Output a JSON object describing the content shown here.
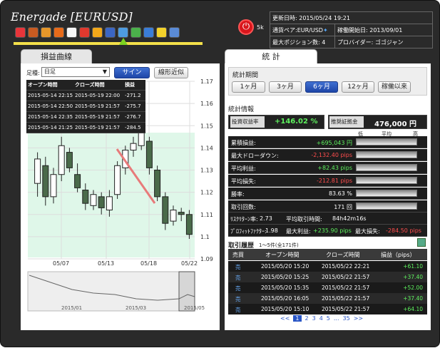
{
  "app": {
    "title": "Energade [EURUSD]",
    "power_label": "5k"
  },
  "toolbar": {
    "icons": [
      "smiley-icon",
      "people-icon",
      "star-person-icon",
      "rocket-icon",
      "top100-icon",
      "fire-icon",
      "coin-icon",
      "swap-flag-icon",
      "chart-up-icon",
      "trade-icon",
      "gear-icon",
      "warning-icon",
      "globe-icon"
    ]
  },
  "info": {
    "updated_label": "更新日時:",
    "updated_value": "2015/05/24 19:21",
    "pair_label": "通貨ペア:",
    "pair_value": "EUR/USD",
    "start_label": "稼働開始日:",
    "start_value": "2013/09/01",
    "maxpos_label": "最大ポジション数:",
    "maxpos_value": "4",
    "provider_label": "プロバイダー:",
    "provider_value": "ゴゴジャン"
  },
  "left": {
    "tab": "損益曲線",
    "foot_label": "足種:",
    "foot_value": "日足",
    "sign_button": "サイン",
    "approx_button": "線形近似"
  },
  "trades": {
    "headers": [
      "オープン時間",
      "クローズ時間",
      "損益"
    ],
    "rows": [
      [
        "2015-05-14 22:15",
        "2015-05-19 22:00",
        "-271.2"
      ],
      [
        "2015-05-14 22:50",
        "2015-05-19 21:57",
        "-275.7"
      ],
      [
        "2015-05-14 22:35",
        "2015-05-19 21:57",
        "-276.7"
      ],
      [
        "2015-05-14 21:25",
        "2015-05-19 21:57",
        "-284.5"
      ]
    ]
  },
  "chart_data": {
    "type": "candlestick",
    "x_ticks": [
      "05/07",
      "05/13",
      "05/18",
      "05/22"
    ],
    "y_ticks": [
      "1.17",
      "1.16",
      "1.15",
      "1.14",
      "1.13",
      "1.12",
      "1.11",
      "1.1",
      "1.09"
    ],
    "ylim": [
      1.09,
      1.17
    ],
    "mini_ticks": [
      "2015/01",
      "2015/03",
      "2015/05"
    ],
    "candles": [
      [
        1.124,
        1.135,
        1.118,
        1.138
      ],
      [
        1.132,
        1.118,
        1.114,
        1.136
      ],
      [
        1.118,
        1.128,
        1.115,
        1.131
      ],
      [
        1.128,
        1.141,
        1.125,
        1.145
      ],
      [
        1.138,
        1.131,
        1.129,
        1.14
      ],
      [
        1.128,
        1.122,
        1.12,
        1.133
      ],
      [
        1.121,
        1.115,
        1.112,
        1.124
      ],
      [
        1.114,
        1.119,
        1.112,
        1.121
      ],
      [
        1.118,
        1.113,
        1.11,
        1.12
      ],
      [
        1.112,
        1.118,
        1.109,
        1.121
      ],
      [
        1.119,
        1.132,
        1.117,
        1.134
      ],
      [
        1.131,
        1.139,
        1.128,
        1.141
      ],
      [
        1.139,
        1.142,
        1.136,
        1.145
      ],
      [
        1.141,
        1.147,
        1.139,
        1.149
      ],
      [
        1.143,
        1.131,
        1.128,
        1.145
      ],
      [
        1.13,
        1.118,
        1.116,
        1.132
      ],
      [
        1.118,
        1.106,
        1.103,
        1.12
      ],
      [
        1.107,
        1.112,
        1.105,
        1.114
      ],
      [
        1.111,
        1.11,
        1.107,
        1.113
      ],
      [
        1.11,
        1.101,
        1.099,
        1.112
      ]
    ]
  },
  "stats": {
    "tab": "統 計",
    "period_label": "統計期間",
    "periods": [
      "1ヶ月",
      "3ヶ月",
      "6ヶ月",
      "12ヶ月",
      "稼働以来"
    ],
    "active_period": "6ヶ月",
    "info_label": "統計情報",
    "ret_label": "投資収益率",
    "ret_value": "+146.02 %",
    "margin_label": "推奨証拠金",
    "margin_value": "476,000 円",
    "scale_low": "低",
    "scale_mid": "平均",
    "scale_high": "高",
    "rows": [
      {
        "label": "累積損益:",
        "value": "+695,043 円",
        "color": "#5ef15e"
      },
      {
        "label": "最大ドローダウン:",
        "value": "-2,132.40 pips",
        "color": "#ff4d4d"
      },
      {
        "label": "平均利益:",
        "value": "+82.43 pips",
        "color": "#5ef15e"
      },
      {
        "label": "平均損失:",
        "value": "-212.81 pips",
        "color": "#ff4d4d"
      },
      {
        "label": "勝率:",
        "value": "83.63 %",
        "color": "#ffffff"
      },
      {
        "label": "取引回数:",
        "value": "171 回",
        "color": "#ffffff"
      }
    ],
    "risk_label": "ﾘｽｸﾘﾀｰﾝ率:",
    "risk_value": "2.73",
    "hold_label": "平均取引時間:",
    "hold_value": "84h42m16s",
    "pf_label": "ﾌﾟﾛﾌｨｯﾄﾌｧｸﾀｰ:",
    "pf_value": "1.98",
    "maxp_label": "最大利益:",
    "maxp_value": "+235.90 pips",
    "maxl_label": "最大損失:",
    "maxl_value": "-284.50 pips"
  },
  "history": {
    "title": "取引履歴",
    "sub": "1〜5件(全171件)",
    "headers": [
      "売買",
      "オープン時間",
      "クローズ時間",
      "損益（pips）"
    ],
    "rows": [
      [
        "売",
        "2015/05/20 15:20",
        "2015/05/22 22:21",
        "+61.10"
      ],
      [
        "売",
        "2015/05/20 15:25",
        "2015/05/22 21:57",
        "+37.40"
      ],
      [
        "売",
        "2015/05/20 15:35",
        "2015/05/22 21:57",
        "+52.00"
      ],
      [
        "売",
        "2015/05/20 16:05",
        "2015/05/22 21:57",
        "+37.40"
      ],
      [
        "売",
        "2015/05/20 15:10",
        "2015/05/22 21:57",
        "+64.10"
      ]
    ],
    "pages": [
      "<<",
      "1",
      "2",
      "3",
      "4",
      "5",
      "...",
      "35",
      ">>"
    ]
  }
}
